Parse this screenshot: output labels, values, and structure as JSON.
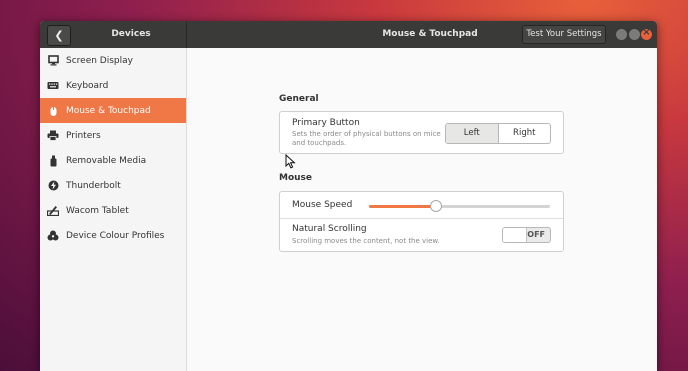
{
  "window": {
    "sidebar_title": "Devices",
    "panel_title": "Mouse & Touchpad",
    "test_button_label": "Test Your Settings"
  },
  "sidebar": {
    "items": [
      {
        "label": "Screen Display",
        "icon": "monitor-icon"
      },
      {
        "label": "Keyboard",
        "icon": "keyboard-icon"
      },
      {
        "label": "Mouse & Touchpad",
        "icon": "mouse-icon",
        "selected": true
      },
      {
        "label": "Printers",
        "icon": "printer-icon"
      },
      {
        "label": "Removable Media",
        "icon": "usb-drive-icon"
      },
      {
        "label": "Thunderbolt",
        "icon": "thunderbolt-icon"
      },
      {
        "label": "Wacom Tablet",
        "icon": "tablet-icon"
      },
      {
        "label": "Device Colour Profiles",
        "icon": "color-profile-icon"
      }
    ]
  },
  "general": {
    "section_title": "General",
    "primary_button": {
      "label": "Primary Button",
      "description": "Sets the order of physical buttons on mice and touchpads.",
      "options": [
        "Left",
        "Right"
      ],
      "selected": "Left"
    }
  },
  "mouse": {
    "section_title": "Mouse",
    "speed": {
      "label": "Mouse Speed",
      "value": 0.37
    },
    "natural_scrolling": {
      "label": "Natural Scrolling",
      "description": "Scrolling moves the content, not the view.",
      "state": "OFF"
    }
  },
  "colors": {
    "accent": "#f07746",
    "titlebar": "#3a3a38",
    "close_button": "#e8613d"
  }
}
